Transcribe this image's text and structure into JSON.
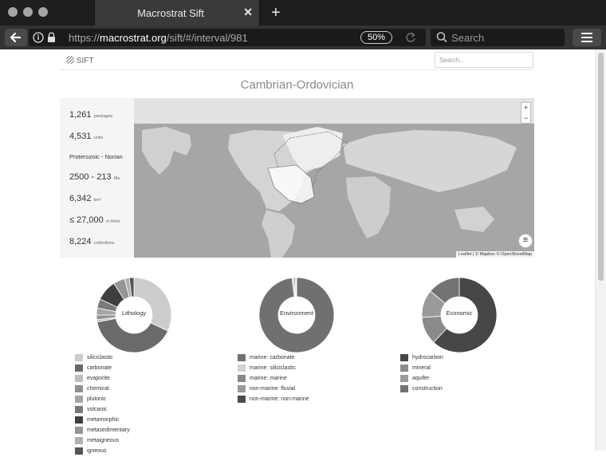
{
  "browser": {
    "tab_title": "Macrostrat Sift",
    "tab_close": "✕",
    "new_tab": "+",
    "url_prefix": "https://",
    "url_host": "macrostrat.org",
    "url_path": "/sift/#/interval/981",
    "zoom_level": "50%",
    "search_placeholder": "Search"
  },
  "site": {
    "logo_text": "SIFT",
    "search_placeholder": "Search...",
    "page_title": "Cambrian-Ordovician"
  },
  "summary": {
    "packages": "1,261",
    "packages_unit": "packages",
    "units": "4,531",
    "units_unit": "units",
    "interval_range": "Proterozoic - Norian",
    "age": "2500 - 213",
    "age_unit": "Ma",
    "area": "6,342",
    "area_unit": "km²",
    "thickness": "≤ 27,000",
    "thickness_unit": "m thick",
    "collections": "8,224",
    "collections_unit": "collections"
  },
  "map": {
    "zoom_in": "+",
    "zoom_out": "−",
    "layers_icon": "≡",
    "attribution": "Leaflet | © Mapbox © OpenStreetMap"
  },
  "chart_data": [
    {
      "type": "pie",
      "title": "Lithology",
      "categories": [
        "siliciclastic",
        "carbonate",
        "evaporite",
        "chemical",
        "plutonic",
        "volcanic",
        "metamorphic",
        "metasedimentary",
        "metaigneous",
        "igneous"
      ],
      "values": [
        32,
        40,
        1,
        2,
        3,
        4,
        9,
        5,
        2,
        2
      ],
      "colors": [
        "#cccccc",
        "#6a6a6a",
        "#bdbdbd",
        "#8f8f8f",
        "#a5a5a5",
        "#7a7a7a",
        "#3f3f3f",
        "#959595",
        "#b0b0b0",
        "#555555"
      ]
    },
    {
      "type": "pie",
      "title": "Environment",
      "categories": [
        "marine: carbonate",
        "marine: siliciclastic",
        "marine: marine",
        "non-marine: fluvial",
        "non-marine: non-marine"
      ],
      "values": [
        98,
        0.8,
        0.6,
        0.4,
        0.2
      ],
      "colors": [
        "#707070",
        "#d2d2d2",
        "#888888",
        "#9a9a9a",
        "#4a4a4a"
      ]
    },
    {
      "type": "pie",
      "title": "Economic",
      "categories": [
        "hydrocarbon",
        "mineral",
        "aquifer",
        "construction"
      ],
      "values": [
        62,
        12,
        12,
        14
      ],
      "colors": [
        "#474747",
        "#8a8a8a",
        "#9a9a9a",
        "#737373"
      ]
    }
  ],
  "legends": {
    "lithology": [
      "siliciclastic",
      "carbonate",
      "evaporite",
      "chemical",
      "plutonic",
      "volcanic",
      "metamorphic",
      "metasedimentary",
      "metaigneous",
      "igneous"
    ],
    "environment": [
      "marine: carbonate",
      "marine: siliciclastic",
      "marine: marine",
      "non-marine: fluvial",
      "non-marine: non-marine"
    ],
    "economic": [
      "hydrocarbon",
      "mineral",
      "aquifer",
      "construction"
    ]
  }
}
